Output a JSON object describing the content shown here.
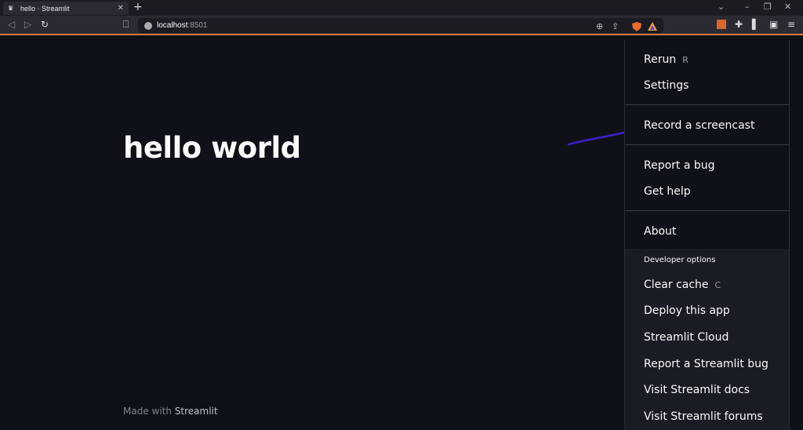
{
  "browser": {
    "tab_title": "hello · Streamlit",
    "url_host": "localhost",
    "url_port": ":8501",
    "accent": "#ea7a3a"
  },
  "app": {
    "heading": "hello world",
    "footer_prefix": "Made with ",
    "footer_brand": "Streamlit"
  },
  "menu": {
    "rerun": {
      "label": "Rerun",
      "shortcut": "R"
    },
    "settings": "Settings",
    "record": "Record a screencast",
    "report_bug": "Report a bug",
    "get_help": "Get help",
    "about": "About",
    "developer_options_label": "Developer options",
    "clear_cache": {
      "label": "Clear cache",
      "shortcut": "C"
    },
    "deploy": "Deploy this app",
    "cloud": "Streamlit Cloud",
    "report_streamlit_bug": "Report a Streamlit bug",
    "docs": "Visit Streamlit docs",
    "forums": "Visit Streamlit forums"
  },
  "annotation": {
    "arrow_color": "#3b1fd0"
  }
}
